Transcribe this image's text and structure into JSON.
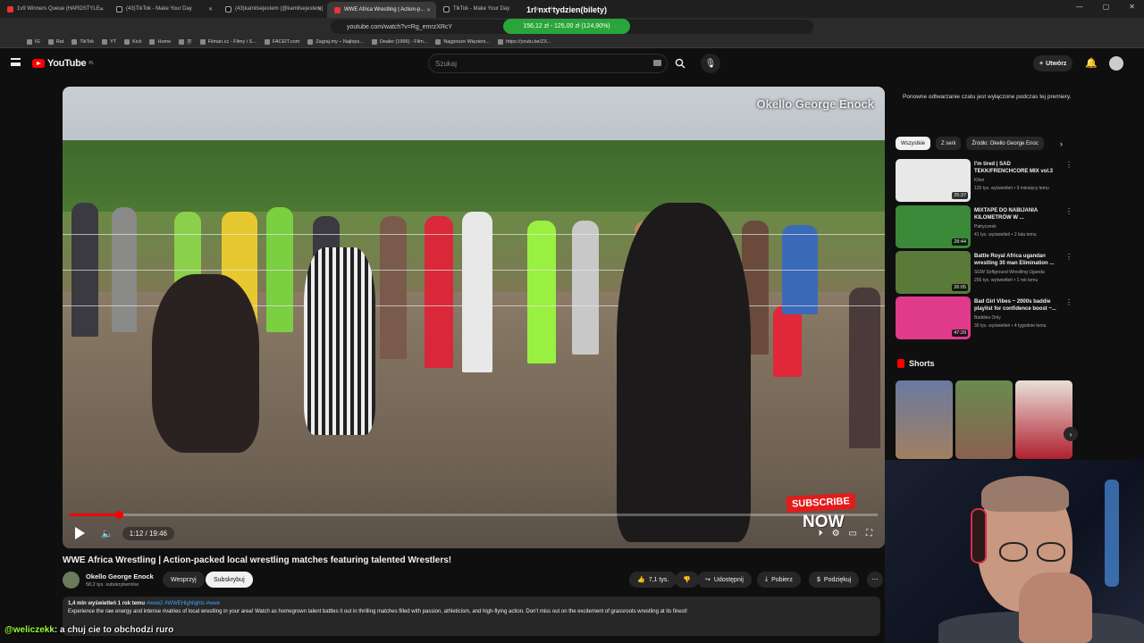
{
  "browser": {
    "tabs": [
      {
        "title": "1v9 Winners Queue (HARDSTYLE..."
      },
      {
        "title": "(43)TikTok - Make Your Day"
      },
      {
        "title": "(43)kamilsejestem (@kamilsejestem)"
      },
      {
        "title": "WWE Africa Wrestling | Action-p..."
      },
      {
        "title": "TikTok - Make Your Day"
      }
    ],
    "banner_text": "1rl nxt tydzien(bilety)",
    "url": "youtube.com/watch?v=Rg_emrzXRcY",
    "goal_pill": "156,12 zł - 125,00 zł (124,90%)",
    "bookmarks": [
      "IG",
      "Rat",
      "TikTok",
      "YT",
      "Kick",
      "Home",
      "芥",
      "Filman.cc - Filmy i S...",
      "FACEIT.com",
      "Zagraj.my – Najleps...",
      "Dealer (1996) - Film...",
      "Najgorsze Więzieni...",
      "https://youtu.be/ZX..."
    ]
  },
  "youtube": {
    "logo": "YouTube",
    "region": "PL",
    "search_placeholder": "Szukaj",
    "create_label": "Utwórz"
  },
  "video": {
    "watermark": "Okello George Enock",
    "time": "1:12 / 19:46",
    "progress": 0.061,
    "subscribe_sticker": "SUBSCRIBE",
    "now_sticker": "NOW",
    "title": "WWE Africa Wrestling | Action-packed local wrestling matches featuring talented Wrestlers!",
    "channel": "Okello George Enock",
    "subscribers": "58,2 tys. subskrybentów",
    "support_label": "Wesprzyj",
    "subscribe_label": "Subskrybuj",
    "likes": "7,1 tys.",
    "share_label": "Udostępnij",
    "download_label": "Pobierz",
    "thanks_label": "Podziękuj",
    "description_meta": "1,4 mln wyświetleń  1 rok temu",
    "tags": "#wwe2 #WWEHighlights #wwe",
    "description": "Experience the raw energy and intense rivalries of local wrestling in your area! Watch as homegrown talent battles it out in thrilling matches filled with passion, athleticism, and high-flying action. Don't miss out on the excitement of grassroots wrestling at its finest!"
  },
  "chat_overlay": {
    "user": "@weliczekk",
    "message": ": a chuj cie to obchodzi ruro"
  },
  "sidebar": {
    "chat_note": "Ponowne odtwarzanie czatu jest wyłączone podczas tej premiery.",
    "chips": [
      "Wszystkie",
      "Z serii",
      "Źródło: Okello George Enoc"
    ],
    "recommendations": [
      {
        "title": "I'm tired | SAD TEKK/FRENCHCORE MIX vol.3",
        "channel": "Kihei",
        "stats": "125 tys. wyświetleń • 9 miesięcy temu",
        "duration": "25:37",
        "color": "#e8e8e8"
      },
      {
        "title": "MIXTAPE DO NABIJANIA KILOMETRÓW W ...",
        "channel": "Patryczeek",
        "stats": "41 tys. wyświetleń • 2 lata temu",
        "duration": "28:44",
        "color": "#3a8a3a"
      },
      {
        "title": "Battle Royal Africa ugandan wrestling 30 man Elimination ...",
        "channel": "SGW Softground Wrestling Uganda",
        "stats": "256 tys. wyświetleń • 1 rok temu",
        "duration": "26:05",
        "color": "#5a7a3a"
      },
      {
        "title": "Bad Girl Vibes ~ 2000s baddie playlist for confidence boost ~...",
        "channel": "Baddies Only",
        "stats": "30 tys. wyświetleń • 4 tygodnie temu",
        "duration": "47:29",
        "color": "#e03a8a"
      }
    ],
    "shorts_title": "Shorts"
  }
}
